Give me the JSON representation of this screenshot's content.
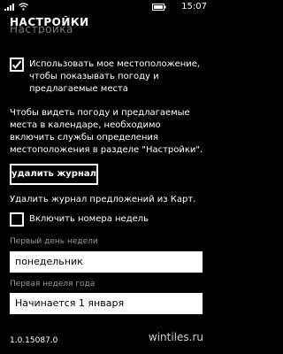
{
  "status_bar": {
    "time": "15:07",
    "signal_icon": "signal-bars-icon",
    "wifi_icon": "wifi-icon",
    "battery_icon": "battery-icon"
  },
  "header": {
    "title": "НАСТРОЙКИ",
    "subtitle_partial": "Настройка"
  },
  "settings": {
    "location": {
      "checked": true,
      "label": "Использовать мое местоположение, чтобы показывать погоду и предлагаемые места"
    },
    "info_text": "Чтобы видеть погоду и предлагаемые места в календаре, необходимо включить службы определения местоположения в разделе \"Настройки\".",
    "clear_button_label": "удалить журнал",
    "clear_description": "Удалить журнал предложений из Карт.",
    "week_numbers": {
      "checked": false,
      "label": "Включить номера недель"
    },
    "first_day": {
      "label": "Первый день недели",
      "value": "понедельник"
    },
    "first_week": {
      "label": "Первая неделя года",
      "value": "Начинается 1 января"
    }
  },
  "version": "1.0.15087.0",
  "watermark": "wintiles.ru",
  "colors": {
    "background": "#000000",
    "foreground": "#ffffff",
    "secondary_text": "#9a9a9a"
  }
}
